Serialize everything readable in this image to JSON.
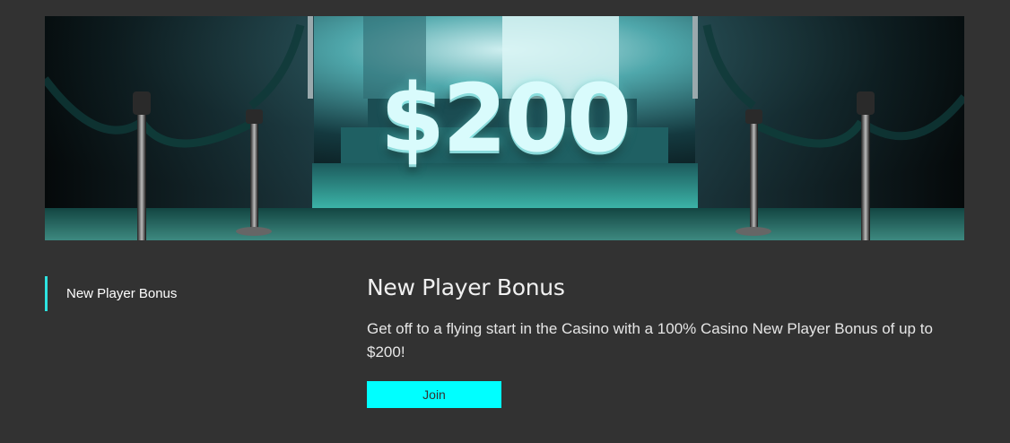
{
  "banner": {
    "amount": "$200"
  },
  "sidebar": {
    "items": [
      {
        "label": "New Player Bonus",
        "active": true
      }
    ]
  },
  "content": {
    "title": "New Player Bonus",
    "description": "Get off to a flying start in the Casino with a 100% Casino New Player Bonus of up to $200!",
    "join_label": "Join"
  },
  "colors": {
    "background": "#323232",
    "accent": "#00ffff",
    "sidebar_indicator": "#2de3e0"
  }
}
